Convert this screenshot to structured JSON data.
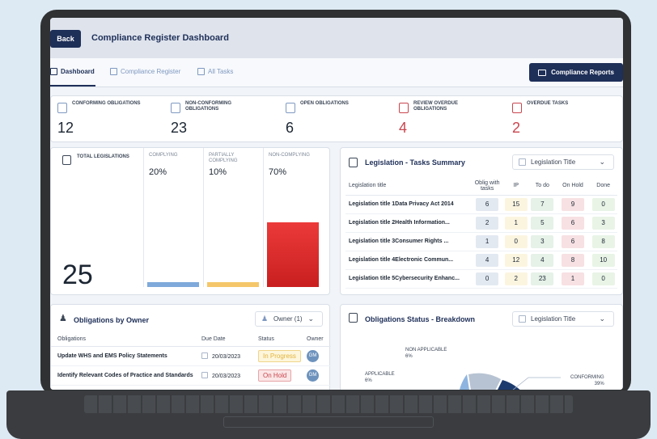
{
  "header": {
    "back_label": "Back",
    "title": "Compliance Register Dashboard"
  },
  "tabs": [
    {
      "label": "Dashboard",
      "icon": "grid-icon",
      "active": true
    },
    {
      "label": "Compliance Register",
      "icon": "register-icon",
      "active": false
    },
    {
      "label": "All Tasks",
      "icon": "tasks-icon",
      "active": false
    }
  ],
  "reports_button": "Compliance Reports",
  "kpis": [
    {
      "label": "CONFORMING OBLIGATIONS",
      "value": "12",
      "color": "#1c2633"
    },
    {
      "label": "NON-CONFORMING OBLIGATIONS",
      "value": "23",
      "color": "#1c2633"
    },
    {
      "label": "OPEN OBLIGATIONS",
      "value": "6",
      "color": "#1c2633"
    },
    {
      "label": "REVIEW OVERDUE OBLIGATIONS",
      "value": "4",
      "color": "#c9464f"
    },
    {
      "label": "OVERDUE TASKS",
      "value": "2",
      "color": "#c9464f"
    }
  ],
  "legislations": {
    "total_label": "TOTAL LEGISLATIONS",
    "total": "25",
    "columns": [
      {
        "label": "COMPLYING",
        "pct": "20%",
        "level": 0.2,
        "color": "#7ea9da"
      },
      {
        "label": "PARTIALLY COMPLYING",
        "pct": "10%",
        "level": 0.1,
        "color": "#f5c76a"
      },
      {
        "label": "NON-COMPLYING",
        "pct": "70%",
        "level": 0.7,
        "color": "#dc2f2f"
      }
    ]
  },
  "tasks_summary": {
    "title": "Legislation - Tasks Summary",
    "dropdown": "Legislation Title",
    "headers": [
      "Legislation title",
      "Oblig with tasks",
      "IP",
      "To do",
      "On Hold",
      "Done"
    ],
    "rows": [
      {
        "title": "Legislation title 1Data Privacy Act 2014",
        "values": [
          "6",
          "15",
          "7",
          "9",
          "0"
        ]
      },
      {
        "title": "Legislation title 2Health Information...",
        "values": [
          "2",
          "1",
          "5",
          "6",
          "3"
        ]
      },
      {
        "title": "Legislation title 3Consumer Rights ...",
        "values": [
          "1",
          "0",
          "3",
          "6",
          "8"
        ]
      },
      {
        "title": "Legislation title 4Electronic Commun...",
        "values": [
          "4",
          "12",
          "4",
          "8",
          "10"
        ]
      },
      {
        "title": "Legislation title 5Cybersecurity Enhanc...",
        "values": [
          "0",
          "2",
          "23",
          "1",
          "0"
        ]
      }
    ],
    "cell_colors": [
      "#e3e9f1",
      "#fbf5e0",
      "#e6f1e8",
      "#f7e1e3",
      "#e9f4e7"
    ]
  },
  "owners": {
    "title": "Obligations by Owner",
    "dropdown": "Owner (1)",
    "headers": [
      "Obligations",
      "Due Date",
      "Status",
      "Owner"
    ],
    "rows": [
      {
        "obligation": "Update WHS and EMS Policy Statements",
        "due": "20/03/2023",
        "status": "In Progress",
        "owner": "GM"
      },
      {
        "obligation": "Identify Relevant Codes of Practice and Standards",
        "due": "20/03/2023",
        "status": "On Hold",
        "owner": "GM"
      }
    ]
  },
  "status_breakdown": {
    "title": "Obligations Status - Breakdown",
    "dropdown": "Legislation Title",
    "labels": [
      {
        "name": "NON APPLICABLE",
        "pct": "6%"
      },
      {
        "name": "APPLICABLE",
        "pct": "6%"
      },
      {
        "name": "CONFORMING",
        "pct": "39%"
      }
    ]
  }
}
